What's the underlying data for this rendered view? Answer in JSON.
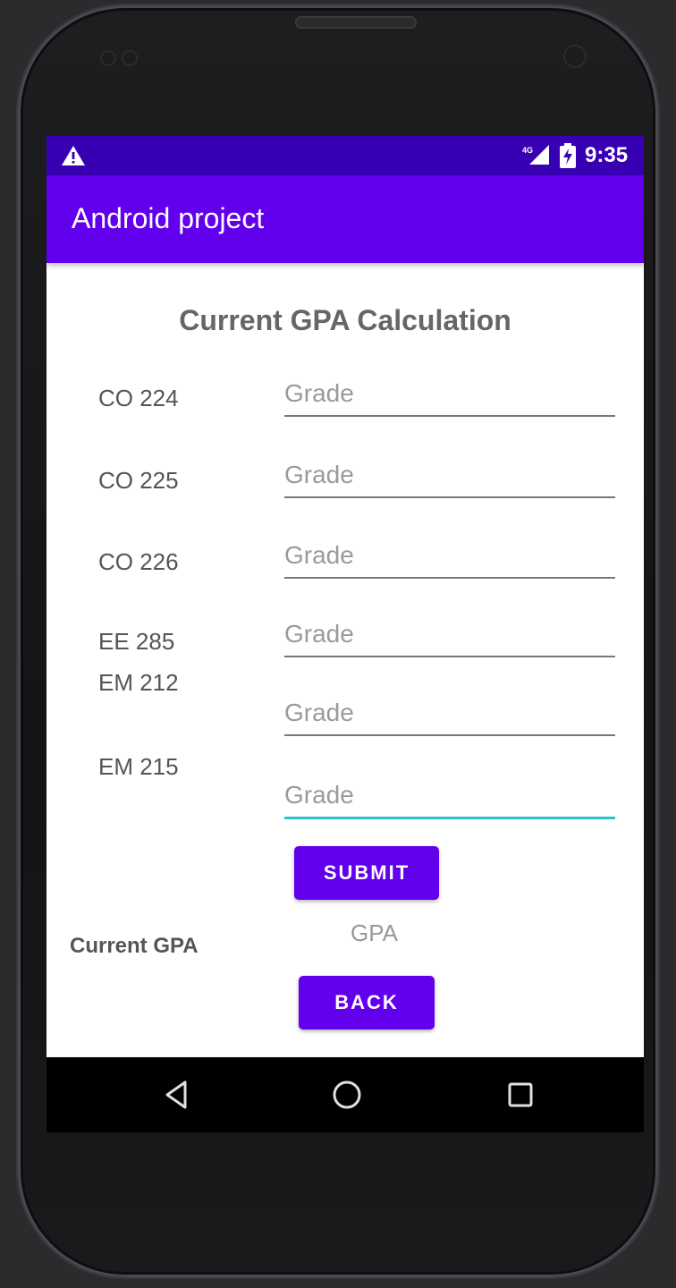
{
  "status_bar": {
    "time": "9:35",
    "network_label": "4G",
    "icons": [
      "warning-icon",
      "network-signal-icon",
      "battery-charging-icon"
    ]
  },
  "app_bar": {
    "title": "Android project"
  },
  "page": {
    "title": "Current GPA Calculation",
    "courses": [
      {
        "code": "CO 224",
        "placeholder": "Grade"
      },
      {
        "code": "CO 225",
        "placeholder": "Grade"
      },
      {
        "code": "CO 226",
        "placeholder": "Grade"
      },
      {
        "code": "EE 285",
        "placeholder": "Grade"
      },
      {
        "code": "EM 212",
        "placeholder": "Grade"
      },
      {
        "code": "EM 215",
        "placeholder": "Grade"
      }
    ],
    "submit_label": "SUBMIT",
    "current_gpa_label": "Current GPA",
    "gpa_value": "GPA",
    "back_label": "BACK"
  },
  "nav_bar": {
    "icons": [
      "back-triangle-icon",
      "home-circle-icon",
      "recents-square-icon"
    ]
  },
  "colors": {
    "status_bar": "#3700b3",
    "app_bar": "#6200ee",
    "button": "#6200ee",
    "focus_underline": "#26c6c6"
  }
}
